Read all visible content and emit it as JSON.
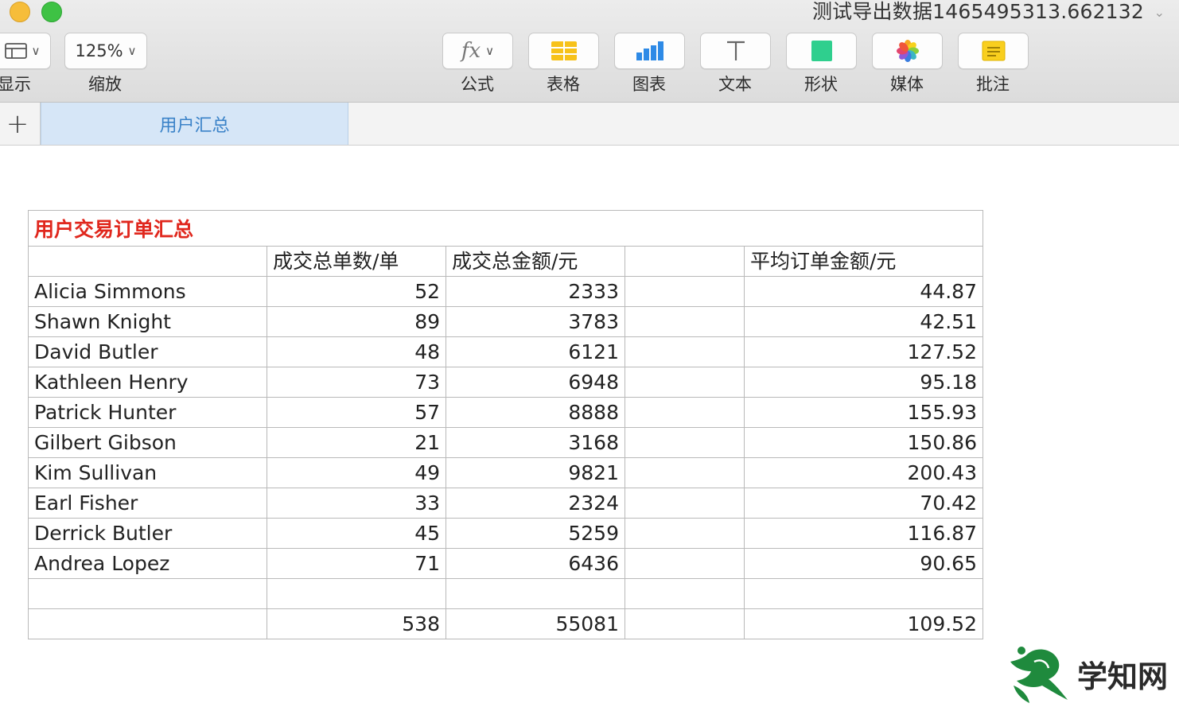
{
  "window": {
    "title": "测试导出数据1465495313.662132"
  },
  "toolbar": {
    "view_label": "显示",
    "zoom_value": "125%",
    "zoom_label": "缩放",
    "formula_label": "公式",
    "table_label": "表格",
    "chart_label": "图表",
    "text_label": "文本",
    "shape_label": "形状",
    "media_label": "媒体",
    "comment_label": "批注"
  },
  "tabs": {
    "active_sheet": "用户汇总"
  },
  "table": {
    "title": "用户交易订单汇总",
    "headers": [
      "",
      "成交总单数/单",
      "成交总金额/元",
      "",
      "平均订单金额/元"
    ],
    "rows": [
      [
        "Alicia Simmons",
        "52",
        "2333",
        "",
        "44.87"
      ],
      [
        "Shawn Knight",
        "89",
        "3783",
        "",
        "42.51"
      ],
      [
        "David Butler",
        "48",
        "6121",
        "",
        "127.52"
      ],
      [
        "Kathleen Henry",
        "73",
        "6948",
        "",
        "95.18"
      ],
      [
        "Patrick Hunter",
        "57",
        "8888",
        "",
        "155.93"
      ],
      [
        "Gilbert Gibson",
        "21",
        "3168",
        "",
        "150.86"
      ],
      [
        "Kim Sullivan",
        "49",
        "9821",
        "",
        "200.43"
      ],
      [
        "Earl Fisher",
        "33",
        "2324",
        "",
        "70.42"
      ],
      [
        "Derrick Butler",
        "45",
        "5259",
        "",
        "116.87"
      ],
      [
        "Andrea Lopez",
        "71",
        "6436",
        "",
        "90.65"
      ],
      [
        "",
        "",
        "",
        "",
        ""
      ],
      [
        "",
        "538",
        "55081",
        "",
        "109.52"
      ]
    ]
  },
  "watermark": {
    "text": "学知网"
  },
  "colors": {
    "title_red": "#e0271d",
    "tab_active_bg": "#d6e6f7",
    "tab_active_text": "#3a82c8",
    "grid_border": "#b9b9b9"
  }
}
